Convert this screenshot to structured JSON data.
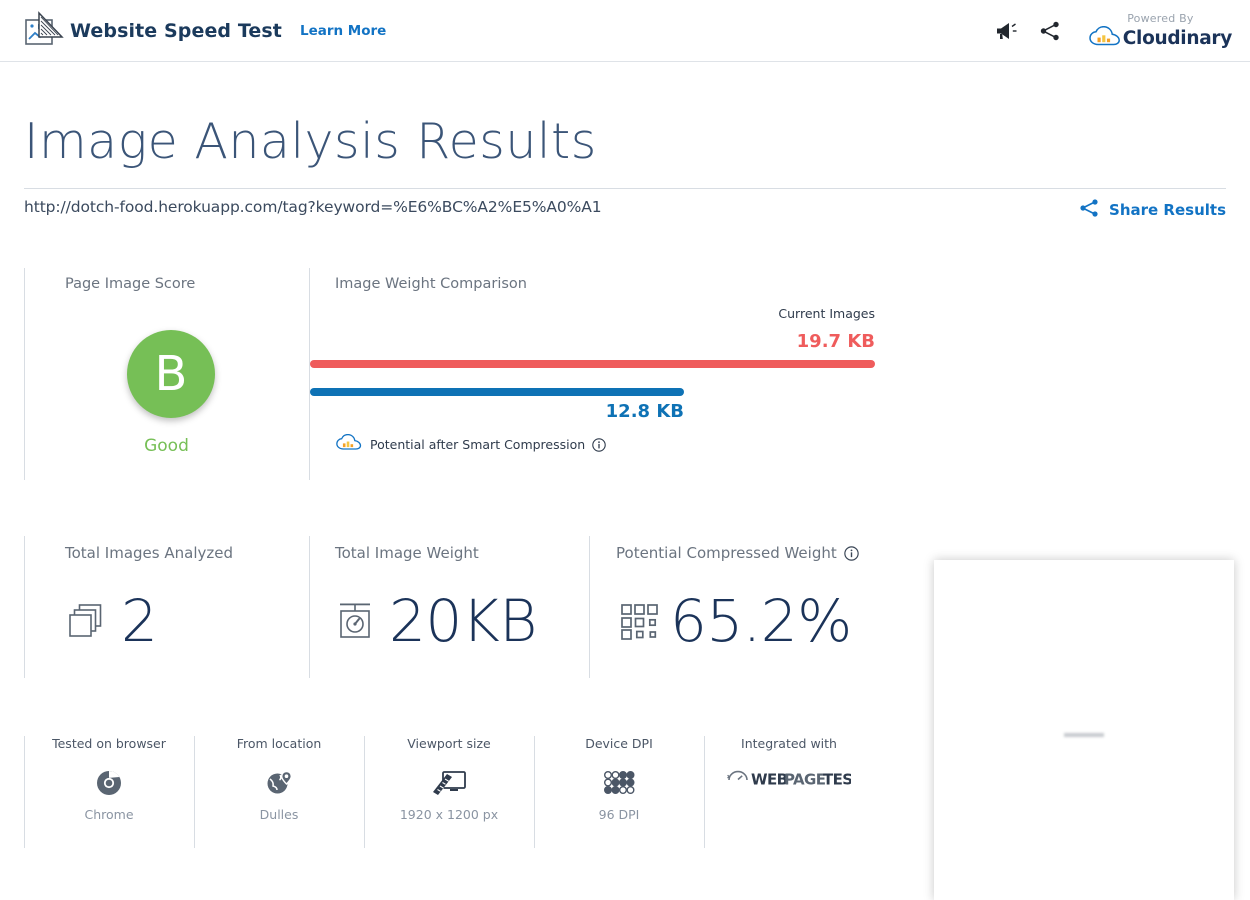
{
  "header": {
    "brand_icon": "chart-cursor-icon",
    "brand_title": "Website Speed Test",
    "learn_more": "Learn More",
    "megaphone_icon": "megaphone-icon",
    "share_icon": "share-icon",
    "powered_by": "Powered By",
    "cloudinary_name": "Cloudinary"
  },
  "page": {
    "title": "Image Analysis Results",
    "url": "http://dotch-food.herokuapp.com/tag?keyword=%E6%BC%A2%E5%A0%A1",
    "share_results_label": "Share Results",
    "share_results_icon": "share-icon"
  },
  "score": {
    "label": "Page Image Score",
    "grade": "B",
    "verdict": "Good",
    "grade_color": "#76bf56",
    "verdict_color": "#76bf56"
  },
  "comparison": {
    "label": "Image Weight Comparison",
    "current_caption": "Current Images",
    "current_value": "19.7 KB",
    "current_color": "#ef5c5c",
    "potential_value": "12.8 KB",
    "potential_color": "#0e72b5",
    "smart_label": "Potential after Smart Compression",
    "smart_icon": "cloudinary-cloud-icon",
    "info_icon": "info-icon"
  },
  "chart_data": {
    "type": "bar",
    "title": "Image Weight Comparison",
    "orientation": "horizontal",
    "categories": [
      "Current Images",
      "Potential after Smart Compression"
    ],
    "values": [
      19.7,
      12.8
    ],
    "unit": "KB",
    "colors": [
      "#ef5c5c",
      "#0e72b5"
    ],
    "labels": [
      "19.7 KB",
      "12.8 KB"
    ],
    "xlabel": "",
    "ylabel": "",
    "xlim": [
      0,
      19.7
    ],
    "grid": false,
    "legend": "none"
  },
  "stats": [
    {
      "title": "Total Images Analyzed",
      "value": "2",
      "icon": "stacked-images-icon",
      "has_info": false
    },
    {
      "title": "Total Image Weight",
      "value": "20KB",
      "icon": "weight-scale-icon",
      "has_info": false
    },
    {
      "title": "Potential Compressed Weight",
      "value": "65.2%",
      "icon": "compression-grid-icon",
      "has_info": true,
      "info_icon": "info-icon"
    }
  ],
  "meta": [
    {
      "title": "Tested on browser",
      "value": "Chrome",
      "icon": "chrome-icon"
    },
    {
      "title": "From location",
      "value": "Dulles",
      "icon": "globe-pin-icon"
    },
    {
      "title": "Viewport size",
      "value": "1920 x 1200 px",
      "icon": "monitor-ruler-icon"
    },
    {
      "title": "Device DPI",
      "value": "96 DPI",
      "icon": "dot-density-icon"
    },
    {
      "title": "Integrated with",
      "value": "",
      "icon": "webpagetest-logo"
    }
  ],
  "thumbnail": {
    "name": "page-screenshot-thumbnail"
  }
}
